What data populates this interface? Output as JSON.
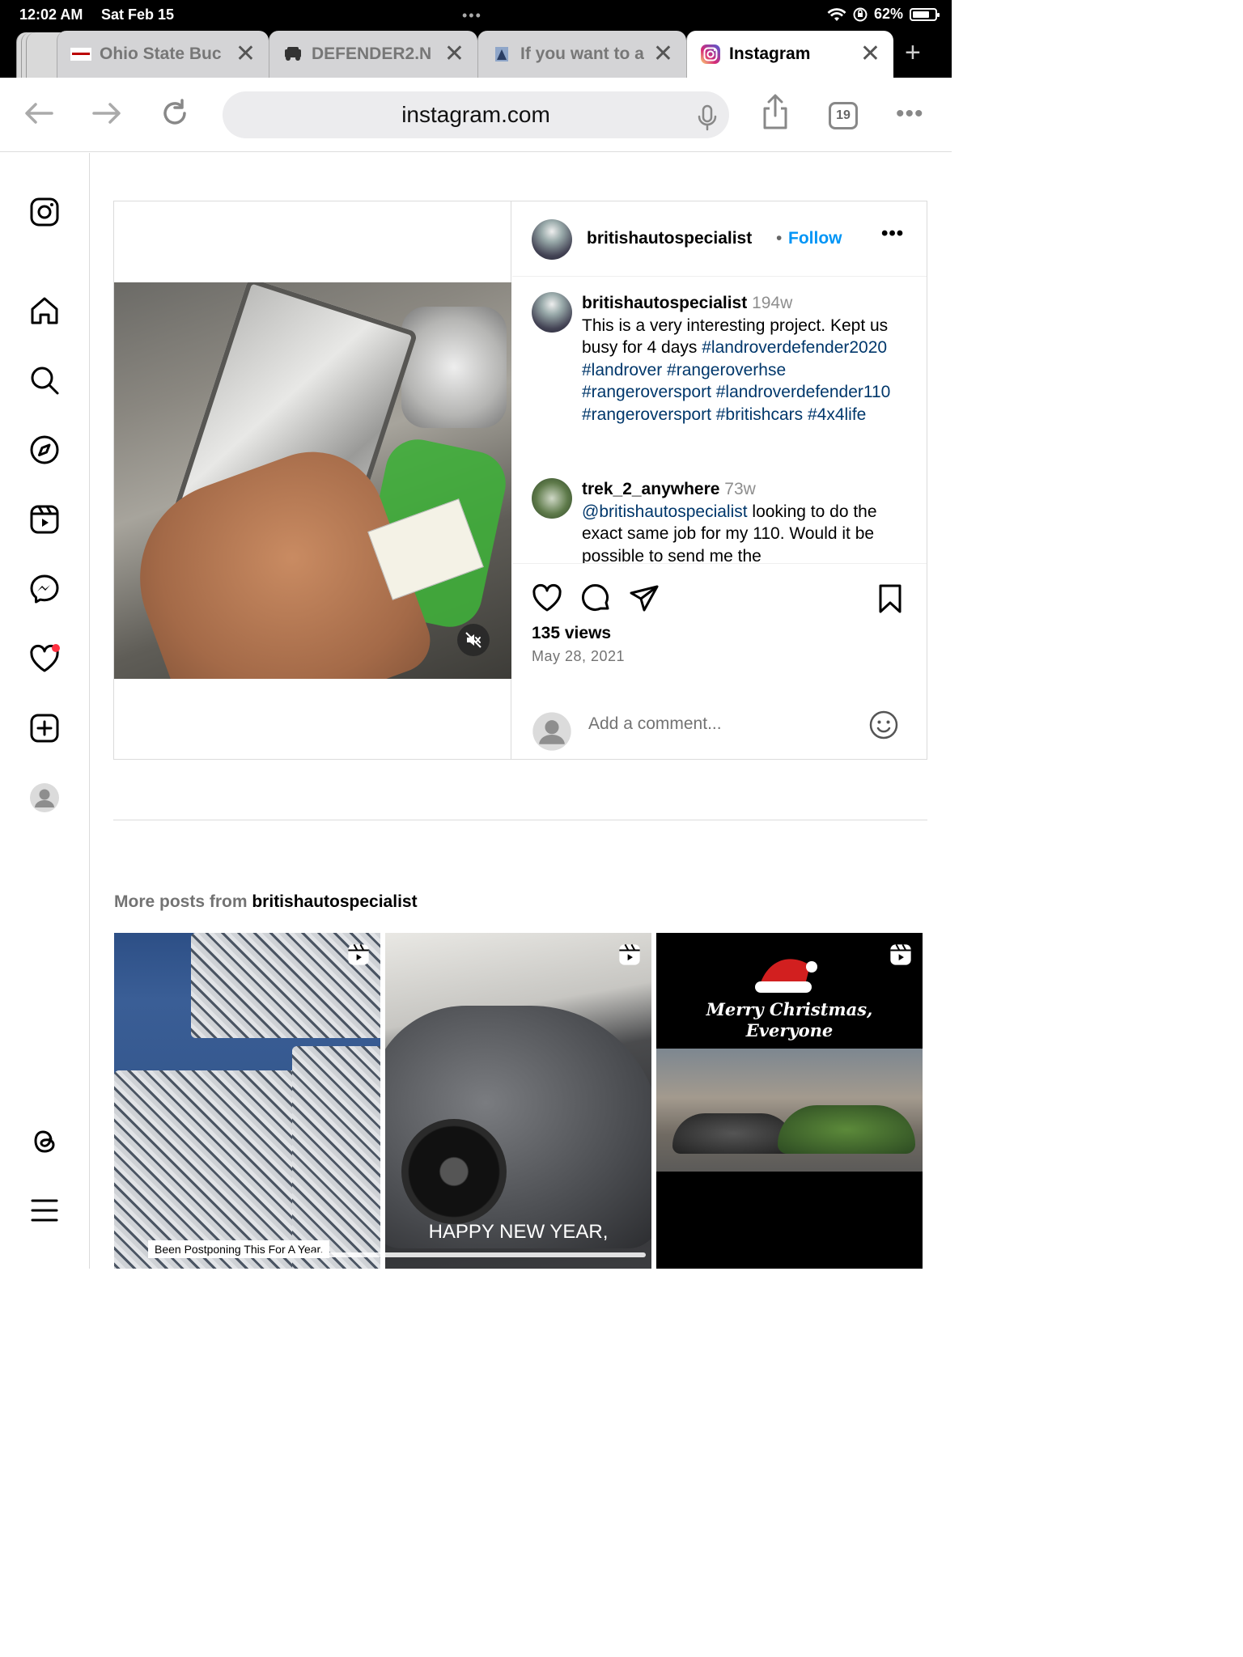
{
  "status_bar": {
    "time": "12:02 AM",
    "date": "Sat Feb 15",
    "battery": "62%"
  },
  "tabs": [
    {
      "title": "Ohio State Buc",
      "active": false
    },
    {
      "title": "DEFENDER2.N",
      "active": false
    },
    {
      "title": "If you want to a",
      "active": false
    },
    {
      "title": "Instagram",
      "active": true
    }
  ],
  "toolbar": {
    "url": "instagram.com",
    "tab_count": "19"
  },
  "post": {
    "author": "britishautospecialist",
    "follow_label": "Follow",
    "caption": {
      "username": "britishautospecialist",
      "age": "194w",
      "text": "This is a very interesting project. Kept us busy for 4 days",
      "hashtags": "#landroverdefender2020 #landrover #rangeroverhse #rangeroversport #landroverdefender110 #rangeroversport #britishcars #4x4life"
    },
    "comment": {
      "username": "trek_2_anywhere",
      "age": "73w",
      "mention": "@britishautospecialist",
      "text": " looking to do the exact same job for my 110. Would it be possible to send me the"
    },
    "views": "135 views",
    "date": "May 28, 2021",
    "add_comment_placeholder": "Add a comment..."
  },
  "more_posts": {
    "prefix": "More posts from ",
    "owner": "britishautospecialist",
    "items": [
      {
        "caption": "Been Postponing This For A Year."
      },
      {
        "caption": "HAPPY NEW YEAR,"
      },
      {
        "caption_line1": "Merry Christmas,",
        "caption_line2": "Everyone"
      }
    ]
  },
  "colors": {
    "link_blue": "#0095f6",
    "hashtag_blue": "#00376b",
    "notification_red": "#ff3040"
  }
}
